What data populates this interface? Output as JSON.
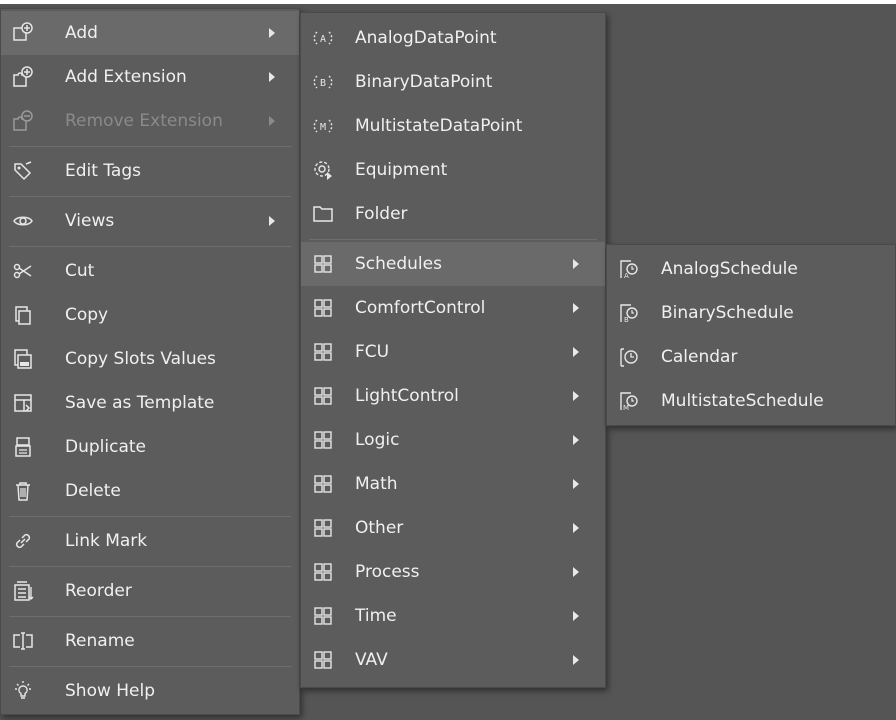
{
  "main_menu": {
    "items": [
      {
        "label": "Add",
        "icon": "add-icon",
        "submenu": true
      },
      {
        "label": "Add Extension",
        "icon": "add-extension-icon",
        "submenu": true
      },
      {
        "label": "Remove Extension",
        "icon": "remove-extension-icon",
        "submenu": true,
        "disabled": true
      },
      {
        "label": "Edit Tags",
        "icon": "tag-icon"
      },
      {
        "label": "Views",
        "icon": "eye-icon",
        "submenu": true
      },
      {
        "label": "Cut",
        "icon": "scissors-icon"
      },
      {
        "label": "Copy",
        "icon": "copy-icon"
      },
      {
        "label": "Copy Slots Values",
        "icon": "copy-slots-icon"
      },
      {
        "label": "Save as Template",
        "icon": "save-template-icon"
      },
      {
        "label": "Duplicate",
        "icon": "duplicate-icon"
      },
      {
        "label": "Delete",
        "icon": "trash-icon"
      },
      {
        "label": "Link Mark",
        "icon": "link-icon"
      },
      {
        "label": "Reorder",
        "icon": "reorder-icon"
      },
      {
        "label": "Rename",
        "icon": "rename-icon"
      },
      {
        "label": "Show Help",
        "icon": "lightbulb-icon"
      }
    ]
  },
  "add_submenu": {
    "items": [
      {
        "label": "AnalogDataPoint",
        "icon": "analog-datapoint-icon"
      },
      {
        "label": "BinaryDataPoint",
        "icon": "binary-datapoint-icon"
      },
      {
        "label": "MultistateDataPoint",
        "icon": "multistate-datapoint-icon"
      },
      {
        "label": "Equipment",
        "icon": "gear-icon"
      },
      {
        "label": "Folder",
        "icon": "folder-icon"
      },
      {
        "label": "Schedules",
        "icon": "grid-icon",
        "submenu": true
      },
      {
        "label": "ComfortControl",
        "icon": "grid-icon",
        "submenu": true
      },
      {
        "label": "FCU",
        "icon": "grid-icon",
        "submenu": true
      },
      {
        "label": "LightControl",
        "icon": "grid-icon",
        "submenu": true
      },
      {
        "label": "Logic",
        "icon": "grid-icon",
        "submenu": true
      },
      {
        "label": "Math",
        "icon": "grid-icon",
        "submenu": true
      },
      {
        "label": "Other",
        "icon": "grid-icon",
        "submenu": true
      },
      {
        "label": "Process",
        "icon": "grid-icon",
        "submenu": true
      },
      {
        "label": "Time",
        "icon": "grid-icon",
        "submenu": true
      },
      {
        "label": "VAV",
        "icon": "grid-icon",
        "submenu": true
      }
    ]
  },
  "schedules_submenu": {
    "items": [
      {
        "label": "AnalogSchedule",
        "icon": "analog-schedule-icon"
      },
      {
        "label": "BinarySchedule",
        "icon": "binary-schedule-icon"
      },
      {
        "label": "Calendar",
        "icon": "calendar-icon"
      },
      {
        "label": "MultistateSchedule",
        "icon": "multistate-schedule-icon"
      }
    ]
  }
}
